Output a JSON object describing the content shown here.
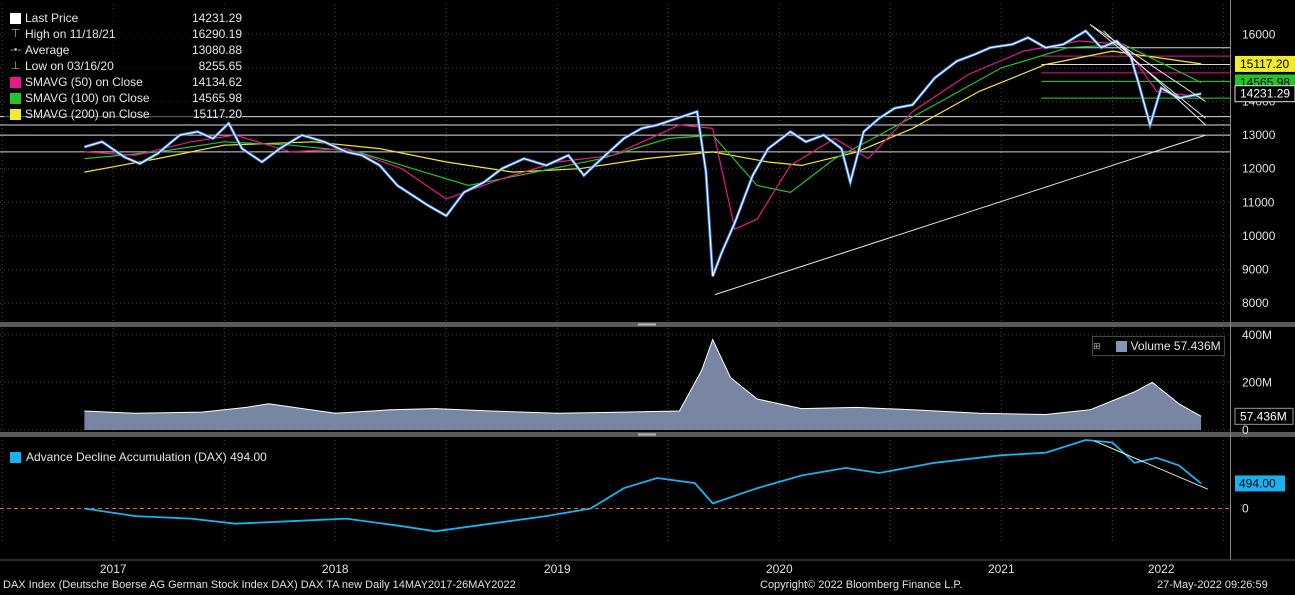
{
  "legend": {
    "items": [
      {
        "label": "Last Price",
        "value": "14231.29",
        "color": "#ffffff",
        "kind": "swatch"
      },
      {
        "label": "High on 11/18/21",
        "value": "16290.19",
        "kind": "glyph",
        "glyph": "⊤"
      },
      {
        "label": "Average",
        "value": "13080.88",
        "kind": "glyph",
        "glyph": "-•-"
      },
      {
        "label": "Low on 03/16/20",
        "value": "8255.65",
        "kind": "glyph",
        "glyph": "⊥"
      },
      {
        "label": "SMAVG (50)  on Close",
        "value": "14134.62",
        "color": "#e8178a",
        "kind": "swatch"
      },
      {
        "label": "SMAVG (100)  on Close",
        "value": "14565.98",
        "color": "#22c42a",
        "kind": "swatch"
      },
      {
        "label": "SMAVG (200)  on Close",
        "value": "15117.20",
        "color": "#f2ea2c",
        "kind": "swatch"
      }
    ]
  },
  "volume_legend": {
    "label": "Volume",
    "value": "57.436M"
  },
  "ad_legend": {
    "label": "Advance Decline Accumulation (DAX)",
    "value": "494.00"
  },
  "footer": {
    "left": "DAX Index (Deutsche Boerse AG German Stock Index DAX) DAX TA new  Daily 14MAY2017-26MAY2022",
    "center": "Copyright© 2022 Bloomberg Finance L.P.",
    "right": "27-May-2022 09:26:59"
  },
  "chart_data": {
    "type": "line",
    "x_labels": [
      "2017",
      "2018",
      "2019",
      "2020",
      "2021",
      "2022"
    ],
    "price": {
      "name": "Last Price",
      "ylim": [
        7500,
        16900
      ],
      "yticks": [
        8000,
        9000,
        10000,
        11000,
        12000,
        13000,
        14000,
        15000,
        16000
      ],
      "x": [
        2017.37,
        2017.45,
        2017.55,
        2017.62,
        2017.7,
        2017.8,
        2017.88,
        2017.95,
        2018.02,
        2018.08,
        2018.17,
        2018.25,
        2018.35,
        2018.45,
        2018.55,
        2018.62,
        2018.7,
        2018.78,
        2018.85,
        2018.92,
        2019.0,
        2019.08,
        2019.17,
        2019.25,
        2019.35,
        2019.45,
        2019.55,
        2019.62,
        2019.7,
        2019.8,
        2019.88,
        2019.95,
        2020.04,
        2020.13,
        2020.17,
        2020.2,
        2020.24,
        2020.3,
        2020.38,
        2020.45,
        2020.55,
        2020.62,
        2020.7,
        2020.78,
        2020.82,
        2020.88,
        2020.95,
        2021.02,
        2021.1,
        2021.2,
        2021.3,
        2021.38,
        2021.45,
        2021.55,
        2021.62,
        2021.7,
        2021.78,
        2021.88,
        2021.95,
        2022.02,
        2022.08,
        2022.12,
        2022.17,
        2022.22,
        2022.3,
        2022.4
      ],
      "y": [
        12650,
        12800,
        12350,
        12150,
        12450,
        13000,
        13100,
        12900,
        13350,
        12600,
        12200,
        12600,
        13000,
        12800,
        12500,
        12400,
        12100,
        11500,
        11200,
        10900,
        10600,
        11300,
        11600,
        12000,
        12300,
        12100,
        12400,
        11800,
        12300,
        12900,
        13200,
        13300,
        13500,
        13700,
        11900,
        8800,
        9500,
        10400,
        11800,
        12600,
        13100,
        12800,
        13000,
        12600,
        11600,
        13100,
        13500,
        13800,
        13900,
        14700,
        15200,
        15400,
        15600,
        15700,
        15900,
        15600,
        15700,
        16100,
        15600,
        15800,
        15400,
        14500,
        13300,
        14400,
        14100,
        14231
      ]
    },
    "sma50": {
      "name": "SMAVG (50)  on Close",
      "color": "#e8178a",
      "x": [
        2017.37,
        2017.6,
        2017.85,
        2018.05,
        2018.3,
        2018.55,
        2018.8,
        2019.0,
        2019.25,
        2019.5,
        2019.75,
        2020.05,
        2020.2,
        2020.3,
        2020.4,
        2020.55,
        2020.75,
        2020.9,
        2021.1,
        2021.35,
        2021.6,
        2021.85,
        2022.05,
        2022.2,
        2022.4
      ],
      "y": [
        12500,
        12400,
        12800,
        13000,
        12500,
        12600,
        12000,
        11100,
        11700,
        12200,
        12400,
        13300,
        13200,
        10200,
        10500,
        12100,
        12900,
        12300,
        13700,
        14800,
        15500,
        15800,
        15700,
        14300,
        14134
      ]
    },
    "sma100": {
      "name": "SMAVG (100)  on Close",
      "color": "#22c42a",
      "x": [
        2017.37,
        2017.7,
        2018.0,
        2018.3,
        2018.6,
        2018.9,
        2019.1,
        2019.4,
        2019.7,
        2020.0,
        2020.2,
        2020.4,
        2020.55,
        2020.75,
        2020.95,
        2021.2,
        2021.5,
        2021.8,
        2022.05,
        2022.4
      ],
      "y": [
        12300,
        12500,
        12800,
        12700,
        12500,
        11900,
        11500,
        11900,
        12300,
        12900,
        13000,
        11500,
        11300,
        12300,
        13000,
        13900,
        15000,
        15600,
        15700,
        14566
      ]
    },
    "sma200": {
      "name": "SMAVG (200)  on Close",
      "color": "#f2ea2c",
      "x": [
        2017.37,
        2017.7,
        2018.0,
        2018.4,
        2018.7,
        2019.0,
        2019.3,
        2019.6,
        2019.9,
        2020.2,
        2020.45,
        2020.6,
        2020.85,
        2021.1,
        2021.4,
        2021.7,
        2022.0,
        2022.4
      ],
      "y": [
        11900,
        12300,
        12700,
        12800,
        12600,
        12200,
        11900,
        12000,
        12300,
        12500,
        12200,
        12100,
        12500,
        13200,
        14300,
        15100,
        15500,
        15117
      ]
    },
    "horizontal_levels": [
      12500,
      13000,
      13300,
      13550,
      14100,
      14600,
      14850,
      15100,
      15350,
      15600
    ],
    "trendlines": [
      {
        "from": [
          2020.21,
          8255
        ],
        "to": [
          2022.42,
          13000
        ]
      },
      {
        "from": [
          2021.9,
          16290
        ],
        "to": [
          2022.42,
          14000
        ]
      },
      {
        "from": [
          2021.9,
          16290
        ],
        "to": [
          2022.42,
          13500
        ]
      },
      {
        "from": [
          2021.96,
          16100
        ],
        "to": [
          2022.42,
          13300
        ]
      }
    ],
    "price_tags": [
      {
        "label": "15117.20",
        "value": 15117.2,
        "color": "#f2ea2c"
      },
      {
        "label": "14565.98",
        "value": 14565.98,
        "color": "#22c42a"
      },
      {
        "label": "14231.29",
        "value": 14231.29,
        "color": "#ffffff"
      }
    ],
    "volume": {
      "name": "Volume",
      "ylim": [
        0,
        420
      ],
      "yticks": [
        0,
        200,
        400
      ],
      "ytick_labels": [
        "0",
        "200M",
        "400M"
      ],
      "x": [
        2017.37,
        2017.6,
        2017.9,
        2018.1,
        2018.2,
        2018.5,
        2018.75,
        2018.95,
        2019.2,
        2019.5,
        2019.8,
        2020.05,
        2020.15,
        2020.2,
        2020.28,
        2020.4,
        2020.6,
        2020.85,
        2021.1,
        2021.4,
        2021.7,
        2021.9,
        2022.1,
        2022.18,
        2022.3,
        2022.4
      ],
      "y": [
        80,
        70,
        75,
        95,
        110,
        70,
        85,
        90,
        80,
        70,
        75,
        80,
        250,
        380,
        220,
        130,
        90,
        95,
        85,
        70,
        65,
        85,
        160,
        200,
        110,
        57.436
      ]
    },
    "advance_decline": {
      "name": "Advance Decline Accumulation (DAX)",
      "ylim": [
        -700,
        1350
      ],
      "yticks": [
        0
      ],
      "x": [
        2017.37,
        2017.6,
        2017.85,
        2018.05,
        2018.3,
        2018.55,
        2018.8,
        2018.95,
        2019.2,
        2019.45,
        2019.65,
        2019.8,
        2019.95,
        2020.12,
        2020.2,
        2020.4,
        2020.6,
        2020.8,
        2020.95,
        2021.2,
        2021.5,
        2021.7,
        2021.88,
        2022.0,
        2022.1,
        2022.2,
        2022.3,
        2022.4
      ],
      "y": [
        0,
        -150,
        -200,
        -300,
        -250,
        -200,
        -350,
        -450,
        -300,
        -150,
        0,
        400,
        600,
        500,
        100,
        400,
        650,
        800,
        700,
        900,
        1050,
        1100,
        1350,
        1300,
        900,
        1000,
        850,
        494
      ]
    }
  }
}
